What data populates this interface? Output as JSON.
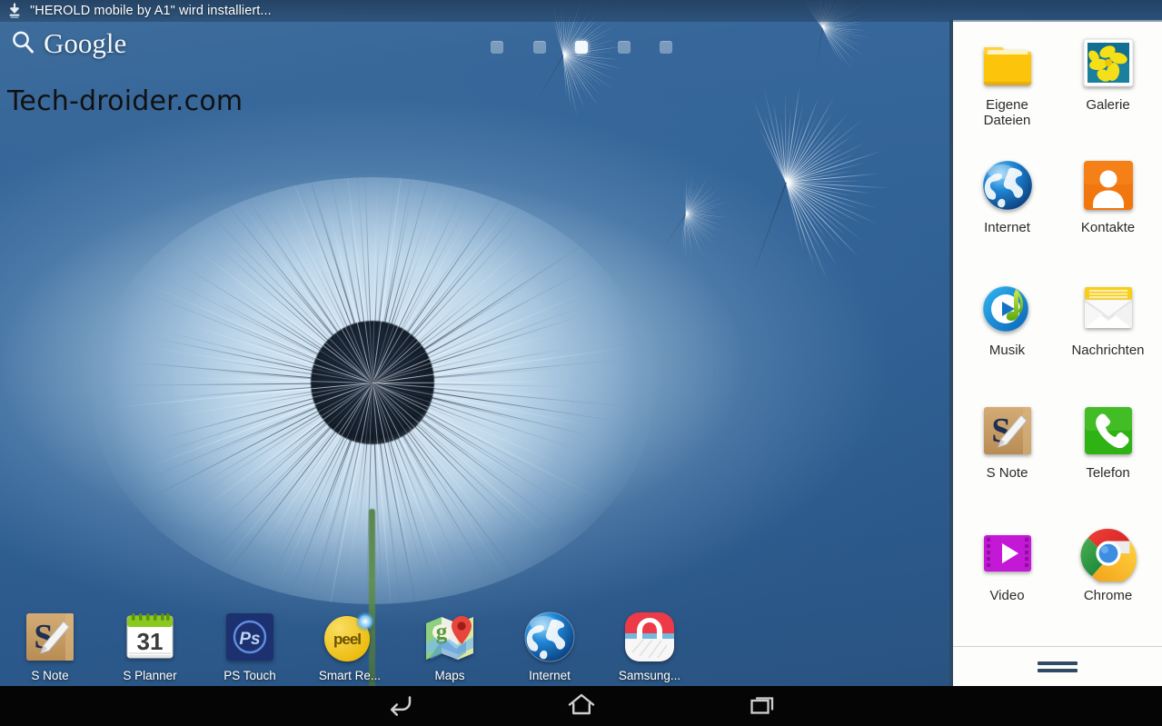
{
  "status_bar": {
    "icon": "download-icon",
    "text": "\"HEROLD mobile by A1\" wird installiert..."
  },
  "search": {
    "icon": "search-icon",
    "label": "Google"
  },
  "watermark": {
    "text": "Tech-droider.com"
  },
  "home": {
    "page_indicator": {
      "total": 5,
      "active_index": 2
    }
  },
  "dock": {
    "apps": [
      {
        "label": "S Note",
        "icon": "s-note-icon"
      },
      {
        "label": "S Planner",
        "icon": "s-planner-icon",
        "day": "31"
      },
      {
        "label": "PS Touch",
        "icon": "ps-touch-icon",
        "glyph": "Ps"
      },
      {
        "label": "Smart Re...",
        "icon": "smart-remote-icon",
        "glyph": "peel"
      },
      {
        "label": "Maps",
        "icon": "maps-icon"
      },
      {
        "label": "Internet",
        "icon": "internet-globe-icon"
      },
      {
        "label": "Samsung...",
        "icon": "samsung-apps-icon"
      }
    ]
  },
  "app_drawer": {
    "apps": [
      {
        "label": "Eigene\nDateien",
        "icon": "folder-icon"
      },
      {
        "label": "Galerie",
        "icon": "gallery-icon"
      },
      {
        "label": "Internet",
        "icon": "internet-globe-icon"
      },
      {
        "label": "Kontakte",
        "icon": "contacts-icon"
      },
      {
        "label": "Musik",
        "icon": "music-icon"
      },
      {
        "label": "Nachrichten",
        "icon": "messages-envelope-icon"
      },
      {
        "label": "S Note",
        "icon": "s-note-icon"
      },
      {
        "label": "Telefon",
        "icon": "phone-icon"
      },
      {
        "label": "Video",
        "icon": "video-icon"
      },
      {
        "label": "Chrome",
        "icon": "chrome-icon"
      }
    ],
    "handle": "drag-handle-icon"
  },
  "nav_bar": {
    "buttons": [
      {
        "name": "back",
        "icon": "back-arrow-icon"
      },
      {
        "name": "home",
        "icon": "home-icon"
      },
      {
        "name": "recent",
        "icon": "recent-apps-icon"
      }
    ]
  },
  "colors": {
    "wallpaper_blue": "#336498",
    "drawer_bg": "#fdfdfb",
    "drawer_border": "#2e4a66",
    "nav_bg": "#050505",
    "accent_orange": "#f2760e",
    "accent_green": "#3cb328",
    "accent_purple": "#c318d6",
    "status_text": "#ffffff"
  }
}
